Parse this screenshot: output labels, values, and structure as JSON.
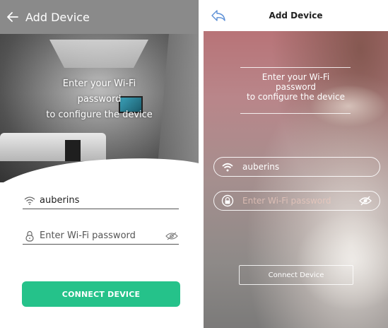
{
  "left": {
    "header": {
      "back_icon": "arrow-left-icon",
      "title": "Add Device"
    },
    "hero": {
      "line1": "Enter your Wi-Fi",
      "line2": "password",
      "line3": "to configure the device"
    },
    "ssid_field": {
      "icon": "wifi-icon",
      "value": "auberins"
    },
    "password_field": {
      "icon": "lock-icon",
      "placeholder": "Enter Wi-Fi password",
      "toggle_icon": "eye-slash-icon"
    },
    "connect_button": {
      "label": "CONNECT DEVICE",
      "color": "#25c28a"
    },
    "header_color": "#8a8a8a"
  },
  "right": {
    "header": {
      "back_icon": "back-arrow-icon",
      "title": "Add Device"
    },
    "hero": {
      "line1": "Enter your Wi-Fi",
      "line2": "password",
      "line3": "to configure the device"
    },
    "ssid_field": {
      "icon": "wifi-icon",
      "value": "auberins"
    },
    "password_field": {
      "icon": "lock-circle-icon",
      "placeholder": "Enter Wi-Fi password",
      "toggle_icon": "eye-slash-icon"
    },
    "connect_button": {
      "label": "Connect Device"
    }
  }
}
